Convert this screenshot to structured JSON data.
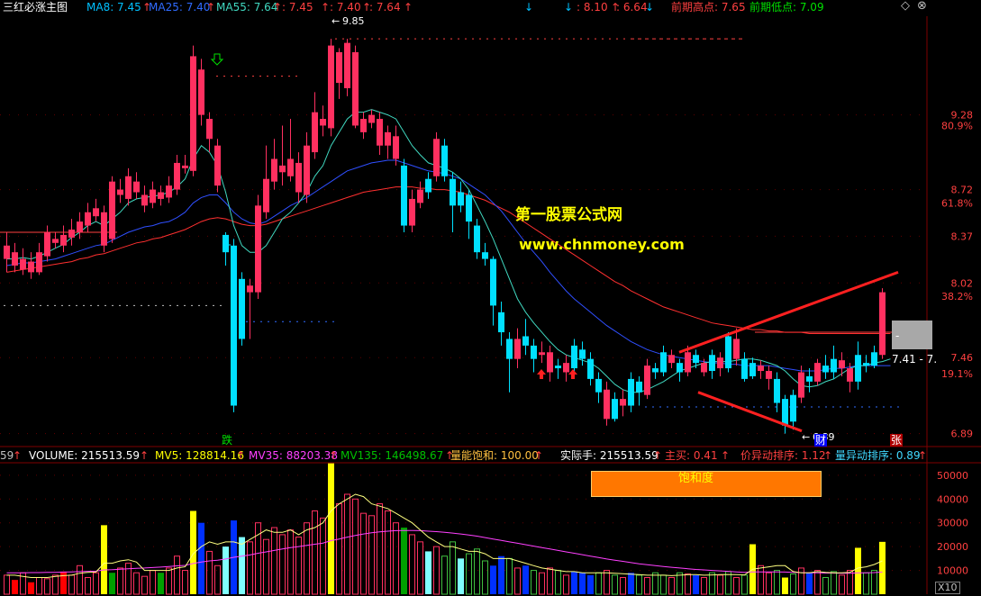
{
  "header": {
    "title": "三红必涨主图",
    "ma8_label": "MA8: 7.45",
    "ma25_label": "MA25: 7.40",
    "ma55_label": "MA55: 7.64",
    "v1": ": 7.45",
    "v2": ": 7.40",
    "v3": ": 7.64",
    "v4": ": 8.10",
    "v5": ": 6.64",
    "prev_high_label": "前期高点: 7.65",
    "prev_low_label": "前期低点: 7.09",
    "arrow_up": "↑",
    "arrow_down": "↓"
  },
  "price_axis": {
    "ticks": [
      {
        "price": 9.28,
        "label": "9.28"
      },
      {
        "price": 8.72,
        "label": "8.72"
      },
      {
        "price": 8.37,
        "label": "8.37"
      },
      {
        "price": 8.02,
        "label": "8.02"
      },
      {
        "price": 7.46,
        "label": "7.46"
      },
      {
        "price": 6.89,
        "label": "6.89"
      }
    ],
    "pct_ticks": [
      {
        "price": 9.2,
        "label": "80.9%"
      },
      {
        "price": 8.62,
        "label": "61.8%"
      },
      {
        "price": 7.92,
        "label": "38.2%"
      },
      {
        "price": 7.34,
        "label": "19.1%"
      }
    ]
  },
  "annotations": {
    "high_label": "9.85",
    "low_label": "6.89",
    "range_label": "7.41 - 7.",
    "watermark_cn": "第一股票公式网",
    "watermark_url": "www.chnmoney.com",
    "die_label": "跌",
    "cai_label": "财",
    "zhang_label": "张",
    "dash": "-"
  },
  "volume_header": {
    "cut": "59",
    "volume": "VOLUME: 215513.59",
    "mv5": "MV5: 128814.16",
    "mv35": "MV35: 88203.38",
    "mv135": "MV135: 146498.67",
    "saturation": "量能饱和: 100.00",
    "actual": "实际手: 215513.59",
    "main_buy": "主买: 0.41",
    "price_rank": "价异动排序: 1.12",
    "vol_rank": "量异动排序: 0.89",
    "arrow": "↑"
  },
  "volume_axis": {
    "ticks": [
      {
        "v": 50000,
        "label": "50000"
      },
      {
        "v": 40000,
        "label": "40000"
      },
      {
        "v": 30000,
        "label": "30000"
      },
      {
        "v": 20000,
        "label": "20000"
      },
      {
        "v": 10000,
        "label": "10000"
      }
    ],
    "unit": "X10"
  },
  "saturation_box": {
    "label": "饱和度"
  },
  "chart_data": {
    "type": "candlestick",
    "price_range": [
      6.82,
      10.02
    ],
    "candles": [
      [
        8.2,
        8.3,
        8.4,
        8.1
      ],
      [
        8.25,
        8.15,
        8.32,
        8.1
      ],
      [
        8.12,
        8.2,
        8.28,
        8.08
      ],
      [
        8.18,
        8.1,
        8.25,
        8.05
      ],
      [
        8.1,
        8.25,
        8.32,
        8.08
      ],
      [
        8.22,
        8.4,
        8.45,
        8.18
      ],
      [
        8.35,
        8.32,
        8.4,
        8.28
      ],
      [
        8.3,
        8.38,
        8.45,
        8.25
      ],
      [
        8.36,
        8.42,
        8.5,
        8.3
      ],
      [
        8.4,
        8.48,
        8.55,
        8.35
      ],
      [
        8.45,
        8.55,
        8.62,
        8.4
      ],
      [
        8.52,
        8.58,
        8.65,
        8.48
      ],
      [
        8.55,
        8.3,
        8.6,
        8.25
      ],
      [
        8.35,
        8.78,
        8.82,
        8.32
      ],
      [
        8.72,
        8.68,
        8.8,
        8.62
      ],
      [
        8.65,
        8.82,
        8.88,
        8.6
      ],
      [
        8.78,
        8.7,
        8.85,
        8.65
      ],
      [
        8.68,
        8.6,
        8.75,
        8.55
      ],
      [
        8.62,
        8.72,
        8.78,
        8.58
      ],
      [
        8.7,
        8.65,
        8.75,
        8.6
      ],
      [
        8.66,
        8.75,
        8.82,
        8.62
      ],
      [
        8.72,
        8.92,
        8.98,
        8.68
      ],
      [
        8.9,
        8.88,
        8.98,
        8.84
      ],
      [
        8.86,
        9.72,
        9.8,
        8.82
      ],
      [
        9.62,
        9.28,
        9.7,
        9.2
      ],
      [
        9.25,
        9.1,
        9.3,
        9.0
      ],
      [
        9.05,
        8.75,
        9.1,
        8.7
      ],
      [
        8.25,
        8.38,
        8.4,
        8.15
      ],
      [
        8.3,
        7.1,
        8.35,
        7.05
      ],
      [
        7.6,
        8.05,
        8.1,
        7.55
      ],
      [
        8.0,
        7.95,
        8.05,
        7.6
      ],
      [
        7.95,
        8.6,
        8.68,
        7.9
      ],
      [
        8.55,
        8.8,
        9.05,
        8.5
      ],
      [
        8.78,
        8.95,
        9.1,
        8.72
      ],
      [
        8.9,
        8.85,
        9.2,
        8.75
      ],
      [
        8.82,
        8.95,
        9.25,
        8.78
      ],
      [
        8.92,
        8.7,
        9.0,
        8.62
      ],
      [
        8.68,
        9.05,
        9.15,
        8.62
      ],
      [
        9.0,
        9.3,
        9.45,
        8.95
      ],
      [
        9.25,
        9.2,
        9.35,
        9.12
      ],
      [
        9.18,
        9.8,
        9.85,
        9.12
      ],
      [
        9.75,
        9.52,
        9.78,
        9.4
      ],
      [
        9.48,
        9.82,
        9.85,
        9.42
      ],
      [
        9.75,
        9.2,
        9.8,
        9.18
      ],
      [
        9.15,
        9.25,
        9.3,
        9.1
      ],
      [
        9.22,
        9.28,
        9.32,
        9.18
      ],
      [
        9.25,
        9.05,
        9.3,
        8.98
      ],
      [
        9.05,
        9.15,
        9.2,
        8.95
      ],
      [
        9.12,
        8.95,
        9.2,
        8.9
      ],
      [
        8.9,
        8.45,
        8.95,
        8.4
      ],
      [
        8.45,
        8.65,
        8.72,
        8.4
      ],
      [
        8.62,
        8.72,
        8.78,
        8.58
      ],
      [
        8.7,
        8.8,
        8.85,
        8.65
      ],
      [
        8.82,
        9.1,
        9.15,
        8.78
      ],
      [
        9.05,
        8.82,
        9.1,
        8.78
      ],
      [
        8.8,
        8.6,
        8.85,
        8.4
      ],
      [
        8.6,
        8.7,
        8.78,
        8.55
      ],
      [
        8.68,
        8.48,
        8.72,
        8.35
      ],
      [
        8.45,
        8.25,
        8.5,
        8.2
      ],
      [
        8.25,
        8.2,
        8.32,
        8.15
      ],
      [
        8.2,
        7.85,
        8.22,
        7.7
      ],
      [
        7.8,
        7.65,
        7.88,
        7.55
      ],
      [
        7.6,
        7.45,
        7.65,
        7.2
      ],
      [
        7.45,
        7.6,
        7.68,
        7.38
      ],
      [
        7.62,
        7.55,
        7.75,
        7.48
      ],
      [
        7.55,
        7.45,
        7.6,
        7.35
      ],
      [
        7.48,
        7.5,
        7.58,
        7.42
      ],
      [
        7.5,
        7.35,
        7.55,
        7.28
      ],
      [
        7.38,
        7.4,
        7.45,
        7.3
      ],
      [
        7.42,
        7.35,
        7.48,
        7.28
      ],
      [
        7.38,
        7.55,
        7.6,
        7.35
      ],
      [
        7.52,
        7.45,
        7.58,
        7.4
      ],
      [
        7.45,
        7.3,
        7.5,
        7.25
      ],
      [
        7.3,
        7.2,
        7.35,
        7.12
      ],
      [
        7.22,
        7.0,
        7.28,
        6.95
      ],
      [
        7.0,
        7.15,
        7.2,
        6.98
      ],
      [
        7.15,
        7.1,
        7.22,
        7.02
      ],
      [
        7.1,
        7.3,
        7.35,
        7.05
      ],
      [
        7.28,
        7.2,
        7.32,
        7.1
      ],
      [
        7.18,
        7.4,
        7.45,
        7.15
      ],
      [
        7.38,
        7.35,
        7.42,
        7.3
      ],
      [
        7.35,
        7.5,
        7.55,
        7.32
      ],
      [
        7.48,
        7.42,
        7.52,
        7.38
      ],
      [
        7.42,
        7.35,
        7.45,
        7.28
      ],
      [
        7.35,
        7.5,
        7.55,
        7.32
      ],
      [
        7.48,
        7.42,
        7.52,
        7.38
      ],
      [
        7.42,
        7.35,
        7.45,
        7.32
      ],
      [
        7.36,
        7.48,
        7.52,
        7.3
      ],
      [
        7.46,
        7.38,
        7.5,
        7.32
      ],
      [
        7.38,
        7.62,
        7.65,
        7.35
      ],
      [
        7.6,
        7.45,
        7.68,
        7.4
      ],
      [
        7.45,
        7.3,
        7.5,
        7.28
      ],
      [
        7.32,
        7.42,
        7.46,
        7.3
      ],
      [
        7.4,
        7.36,
        7.44,
        7.3
      ],
      [
        7.36,
        7.3,
        7.4,
        7.22
      ],
      [
        7.3,
        7.12,
        7.35,
        7.05
      ],
      [
        7.15,
        6.95,
        7.18,
        6.89
      ],
      [
        6.98,
        7.18,
        7.22,
        6.92
      ],
      [
        7.16,
        7.35,
        7.4,
        7.12
      ],
      [
        7.32,
        7.28,
        7.38,
        7.2
      ],
      [
        7.28,
        7.42,
        7.45,
        7.25
      ],
      [
        7.4,
        7.35,
        7.48,
        7.3
      ],
      [
        7.35,
        7.45,
        7.55,
        7.3
      ],
      [
        7.44,
        7.38,
        7.5,
        7.32
      ],
      [
        7.38,
        7.28,
        7.42,
        7.2
      ],
      [
        7.28,
        7.48,
        7.58,
        7.22
      ],
      [
        7.42,
        7.4,
        7.48,
        7.35
      ],
      [
        7.4,
        7.5,
        7.55,
        7.38
      ],
      [
        7.48,
        7.95,
        7.98,
        7.45
      ]
    ],
    "ma_fast": [
      8.2,
      8.2,
      8.21,
      8.2,
      8.22,
      8.25,
      8.28,
      8.31,
      8.36,
      8.4,
      8.45,
      8.48,
      8.45,
      8.5,
      8.55,
      8.62,
      8.65,
      8.66,
      8.67,
      8.68,
      8.7,
      8.74,
      8.8,
      8.95,
      9.05,
      9.0,
      8.9,
      8.7,
      8.45,
      8.3,
      8.25,
      8.25,
      8.3,
      8.4,
      8.5,
      8.55,
      8.62,
      8.7,
      8.82,
      8.9,
      9.05,
      9.15,
      9.25,
      9.3,
      9.3,
      9.32,
      9.3,
      9.28,
      9.25,
      9.15,
      9.05,
      8.98,
      8.92,
      8.9,
      8.88,
      8.85,
      8.8,
      8.72,
      8.6,
      8.48,
      8.35,
      8.2,
      8.05,
      7.9,
      7.8,
      7.72,
      7.65,
      7.58,
      7.52,
      7.48,
      7.46,
      7.44,
      7.42,
      7.38,
      7.32,
      7.26,
      7.22,
      7.2,
      7.2,
      7.22,
      7.25,
      7.28,
      7.32,
      7.36,
      7.38,
      7.4,
      7.42,
      7.43,
      7.43,
      7.43,
      7.44,
      7.45,
      7.45,
      7.44,
      7.42,
      7.4,
      7.36,
      7.3,
      7.25,
      7.24,
      7.25,
      7.28,
      7.3,
      7.34,
      7.38,
      7.4,
      7.4,
      7.42,
      7.43,
      7.45
    ],
    "ma_mid": [
      8.15,
      8.16,
      8.17,
      8.17,
      8.18,
      8.19,
      8.2,
      8.22,
      8.24,
      8.26,
      8.28,
      8.3,
      8.31,
      8.34,
      8.37,
      8.4,
      8.42,
      8.44,
      8.45,
      8.47,
      8.48,
      8.51,
      8.55,
      8.62,
      8.66,
      8.68,
      8.68,
      8.62,
      8.55,
      8.5,
      8.47,
      8.46,
      8.48,
      8.52,
      8.56,
      8.6,
      8.63,
      8.66,
      8.7,
      8.74,
      8.78,
      8.82,
      8.86,
      8.88,
      8.9,
      8.92,
      8.93,
      8.94,
      8.94,
      8.92,
      8.9,
      8.88,
      8.86,
      8.85,
      8.84,
      8.82,
      8.8,
      8.76,
      8.72,
      8.68,
      8.62,
      8.56,
      8.48,
      8.4,
      8.32,
      8.25,
      8.18,
      8.1,
      8.03,
      7.96,
      7.9,
      7.85,
      7.8,
      7.75,
      7.7,
      7.66,
      7.62,
      7.58,
      7.55,
      7.52,
      7.5,
      7.48,
      7.47,
      7.46,
      7.45,
      7.44,
      7.43,
      7.42,
      7.42,
      7.41,
      7.41,
      7.4,
      7.4,
      7.4,
      7.4,
      7.39,
      7.38,
      7.37,
      7.36,
      7.36,
      7.36,
      7.37,
      7.38,
      7.38,
      7.39,
      7.4,
      7.4,
      7.4,
      7.4,
      7.4
    ],
    "ma_slow": [
      8.1,
      8.11,
      8.12,
      8.13,
      8.14,
      8.15,
      8.16,
      8.17,
      8.18,
      8.2,
      8.21,
      8.23,
      8.24,
      8.26,
      8.28,
      8.3,
      8.32,
      8.33,
      8.35,
      8.36,
      8.38,
      8.4,
      8.42,
      8.45,
      8.48,
      8.5,
      8.51,
      8.5,
      8.48,
      8.46,
      8.45,
      8.45,
      8.46,
      8.48,
      8.5,
      8.52,
      8.54,
      8.56,
      8.58,
      8.6,
      8.62,
      8.64,
      8.66,
      8.68,
      8.7,
      8.71,
      8.72,
      8.73,
      8.74,
      8.74,
      8.74,
      8.73,
      8.73,
      8.72,
      8.72,
      8.71,
      8.7,
      8.68,
      8.66,
      8.64,
      8.61,
      8.58,
      8.55,
      8.51,
      8.47,
      8.43,
      8.39,
      8.35,
      8.31,
      8.27,
      8.23,
      8.19,
      8.15,
      8.11,
      8.07,
      8.03,
      8.0,
      7.96,
      7.93,
      7.9,
      7.87,
      7.84,
      7.82,
      7.8,
      7.78,
      7.76,
      7.74,
      7.72,
      7.71,
      7.7,
      7.69,
      7.68,
      7.67,
      7.67,
      7.66,
      7.66,
      7.65,
      7.65,
      7.65,
      7.64,
      7.64,
      7.64,
      7.64,
      7.64,
      7.64,
      7.64,
      7.64,
      7.64,
      7.64,
      7.64
    ],
    "colored": {
      "27": "cyan",
      "28": "cyan",
      "29": "cyan",
      "49": "cyan",
      "52": "cyan",
      "54": "cyan",
      "55": "cyan",
      "56": "cyan",
      "57": "cyan",
      "58": "cyan",
      "59": "cyan",
      "60": "cyan",
      "61": "cyan",
      "62": "cyan",
      "64": "cyan",
      "65": "cyan",
      "68": "cyan",
      "70": "cyan",
      "71": "cyan",
      "72": "cyan",
      "73": "cyan",
      "75": "cyan",
      "77": "cyan",
      "78": "cyan",
      "80": "cyan",
      "81": "cyan",
      "83": "cyan",
      "85": "cyan",
      "87": "cyan",
      "89": "cyan",
      "91": "cyan",
      "92": "cyan",
      "95": "cyan",
      "96": "cyan",
      "97": "cyan",
      "99": "cyan",
      "101": "cyan",
      "102": "cyan",
      "105": "cyan",
      "106": "cyan",
      "107": "cyan"
    },
    "volume_range": [
      0,
      56000
    ],
    "volume": [
      8000,
      6000,
      9000,
      5000,
      7000,
      6500,
      8000,
      9500,
      8000,
      12000,
      7000,
      9000,
      29000,
      9000,
      11000,
      13000,
      9000,
      7500,
      10000,
      9000,
      11000,
      16000,
      10000,
      35000,
      30000,
      18000,
      12000,
      20000,
      31000,
      24000,
      22000,
      30000,
      23000,
      28000,
      25000,
      27000,
      24000,
      30000,
      35000,
      32000,
      55000,
      38000,
      42000,
      40000,
      34000,
      33000,
      38000,
      35000,
      30000,
      28000,
      25000,
      22000,
      18000,
      20000,
      16000,
      22000,
      15000,
      17000,
      19000,
      14000,
      12000,
      16000,
      15000,
      11000,
      12000,
      10000,
      9000,
      11000,
      10000,
      8000,
      9500,
      9000,
      8000,
      9000,
      10000,
      8000,
      7000,
      9000,
      8000,
      7000,
      9000,
      8000,
      7000,
      9000,
      8500,
      8000,
      7000,
      9000,
      8000,
      9500,
      7000,
      8000,
      21000,
      12000,
      9000,
      10000,
      7000,
      8500,
      11000,
      9000,
      10000,
      7000,
      9500,
      8000,
      10000,
      19500,
      9000,
      10000,
      22000
    ],
    "volume_colors": {
      "12": "yellow",
      "23": "yellow",
      "24": "blue",
      "27": "cyan",
      "28": "blue",
      "29": "cyan",
      "40": "yellow",
      "49": "green",
      "52": "cyan",
      "56": "cyan",
      "60": "blue",
      "61": "blue",
      "64": "blue",
      "70": "blue",
      "71": "blue",
      "72": "blue",
      "77": "blue",
      "85": "blue",
      "92": "yellow",
      "96": "yellow",
      "99": "blue",
      "105": "yellow",
      "108": "yellow",
      "1": "red",
      "3": "red",
      "7": "red",
      "13": "green",
      "19": "green"
    },
    "vol_ma5": [
      8000,
      8000,
      7500,
      7000,
      7000,
      7000,
      7500,
      7800,
      8000,
      8800,
      9200,
      9300,
      13000,
      13000,
      14000,
      14500,
      13500,
      10000,
      10000,
      10000,
      10000,
      11000,
      11500,
      17000,
      20000,
      22000,
      21000,
      22000,
      22000,
      21000,
      23000,
      25000,
      27000,
      26000,
      26000,
      27000,
      25000,
      27000,
      28000,
      30000,
      35000,
      38000,
      40000,
      42000,
      41000,
      38000,
      37000,
      36000,
      34000,
      32000,
      30000,
      27000,
      24000,
      22000,
      20000,
      20000,
      19000,
      18000,
      18000,
      17000,
      15000,
      15000,
      15000,
      14000,
      13000,
      12000,
      11000,
      10500,
      10000,
      9500,
      9500,
      9000,
      9000,
      9000,
      9000,
      8800,
      8600,
      8400,
      8200,
      8000,
      8000,
      8000,
      7800,
      8000,
      8200,
      8200,
      8000,
      8100,
      8200,
      8300,
      8200,
      8100,
      10500,
      11000,
      11500,
      12000,
      12000,
      9500,
      9000,
      9000,
      9500,
      9200,
      9000,
      9000,
      9200,
      11000,
      11500,
      12500,
      14000
    ],
    "vol_ma35": [
      9000,
      9000,
      9000,
      9100,
      9100,
      9200,
      9200,
      9300,
      9400,
      9500,
      9600,
      9700,
      10200,
      10300,
      10500,
      10700,
      10900,
      11000,
      11200,
      11400,
      11600,
      11900,
      12100,
      12900,
      13500,
      14000,
      14300,
      14800,
      15500,
      16000,
      16500,
      17200,
      17800,
      18400,
      19000,
      19600,
      20000,
      20500,
      21000,
      21500,
      22500,
      23200,
      24000,
      24700,
      25300,
      25800,
      26200,
      26500,
      26700,
      26800,
      26800,
      26700,
      26500,
      26300,
      26000,
      25700,
      25300,
      24900,
      24400,
      23800,
      23200,
      22600,
      22000,
      21400,
      20800,
      20200,
      19600,
      19000,
      18400,
      17800,
      17200,
      16600,
      16000,
      15400,
      14800,
      14300,
      13800,
      13300,
      12800,
      12400,
      12000,
      11600,
      11300,
      11000,
      10700,
      10400,
      10200,
      10000,
      9800,
      9600,
      9400,
      9200,
      9400,
      9400,
      9400,
      9400,
      9300,
      9200,
      9100,
      9000,
      9000,
      8900,
      8900,
      8800,
      8800,
      9000,
      9000,
      9100,
      9300
    ]
  }
}
